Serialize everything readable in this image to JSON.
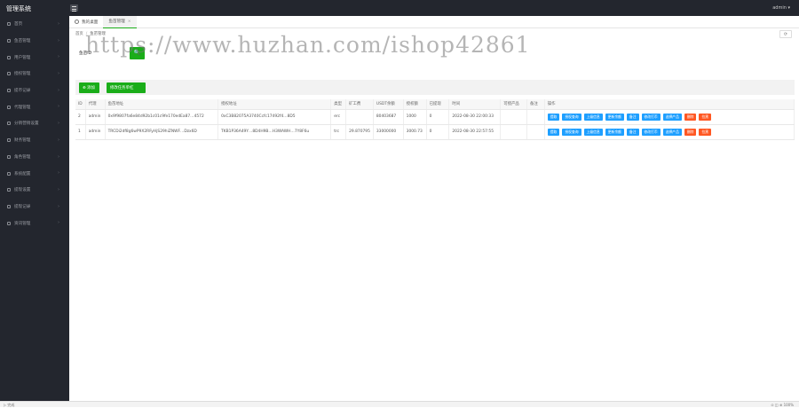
{
  "app": {
    "title": "管理系统",
    "user": "admin ▾"
  },
  "sidebar": {
    "items": [
      {
        "label": "首页"
      },
      {
        "label": "鱼苗管理"
      },
      {
        "label": "用户管理"
      },
      {
        "label": "授权管理"
      },
      {
        "label": "提币记录"
      },
      {
        "label": "代理管理"
      },
      {
        "label": "分销营销设置"
      },
      {
        "label": "财务管理"
      },
      {
        "label": "角色管理"
      },
      {
        "label": "系统配置"
      },
      {
        "label": "提现设置"
      },
      {
        "label": "提现记录"
      },
      {
        "label": "资讯管理"
      }
    ],
    "chevron": "›"
  },
  "tabs": {
    "home": "我的桌面",
    "active": "鱼苗管理",
    "close": "×"
  },
  "breadcrumb": {
    "root": "首页",
    "sep": "/",
    "current": "鱼苗管理"
  },
  "refresh_icon": "⟳",
  "search": {
    "label": "鱼苗ID",
    "button_icon": "🔍"
  },
  "watermark": "https://www.huzhan.com/ishop42861",
  "toolbar": {
    "add": "⊕ 添加",
    "batch": "修改任务单杠"
  },
  "table": {
    "headers": [
      "ID",
      "代理",
      "鱼苗地址",
      "授权地址",
      "类型",
      "矿工费",
      "USDT余额",
      "授权额",
      "已提现",
      "时间",
      "可授产品",
      "备注",
      "操作"
    ],
    "rows": [
      {
        "id": "2",
        "agent": "admin",
        "fish": "0x9f9807fa6e84d92b1c01c9fe170edEa87…4572",
        "auth": "0xC3B82075A3740Ccfc17492f4…8D5",
        "type": "erc",
        "fee": "",
        "usdt": "80403687",
        "approved": "1000",
        "withdrawn": "0",
        "time": "2022-08-30 22:00:33",
        "product": "",
        "remark": ""
      },
      {
        "id": "1",
        "agent": "admin",
        "fish": "TRCDi2df8g6wP9X2RFyHjS29hiZNWF…Dzx6D",
        "auth": "TKB1P36A49Y…8D4H9B…H3WAWH…7Y8F6u",
        "type": "trc",
        "fee": "29.870795",
        "usdt": "33000000",
        "approved": "3000.73",
        "withdrawn": "0",
        "time": "2022-08-30 22:57:55",
        "product": "",
        "remark": ""
      }
    ],
    "ops": [
      "提取",
      "授权查询",
      "上级信息",
      "更新余额",
      "备注",
      "修改打币",
      "选择产品",
      "删除",
      "拉黑"
    ]
  },
  "statusbar": {
    "left": "▷ 完成",
    "right": "⊙ ◫ ⊕ 100%"
  },
  "colors": {
    "accent": "#1aad19",
    "op_blue": "#1e9fff",
    "op_red": "#ff5722",
    "sidebar": "#23262e"
  }
}
